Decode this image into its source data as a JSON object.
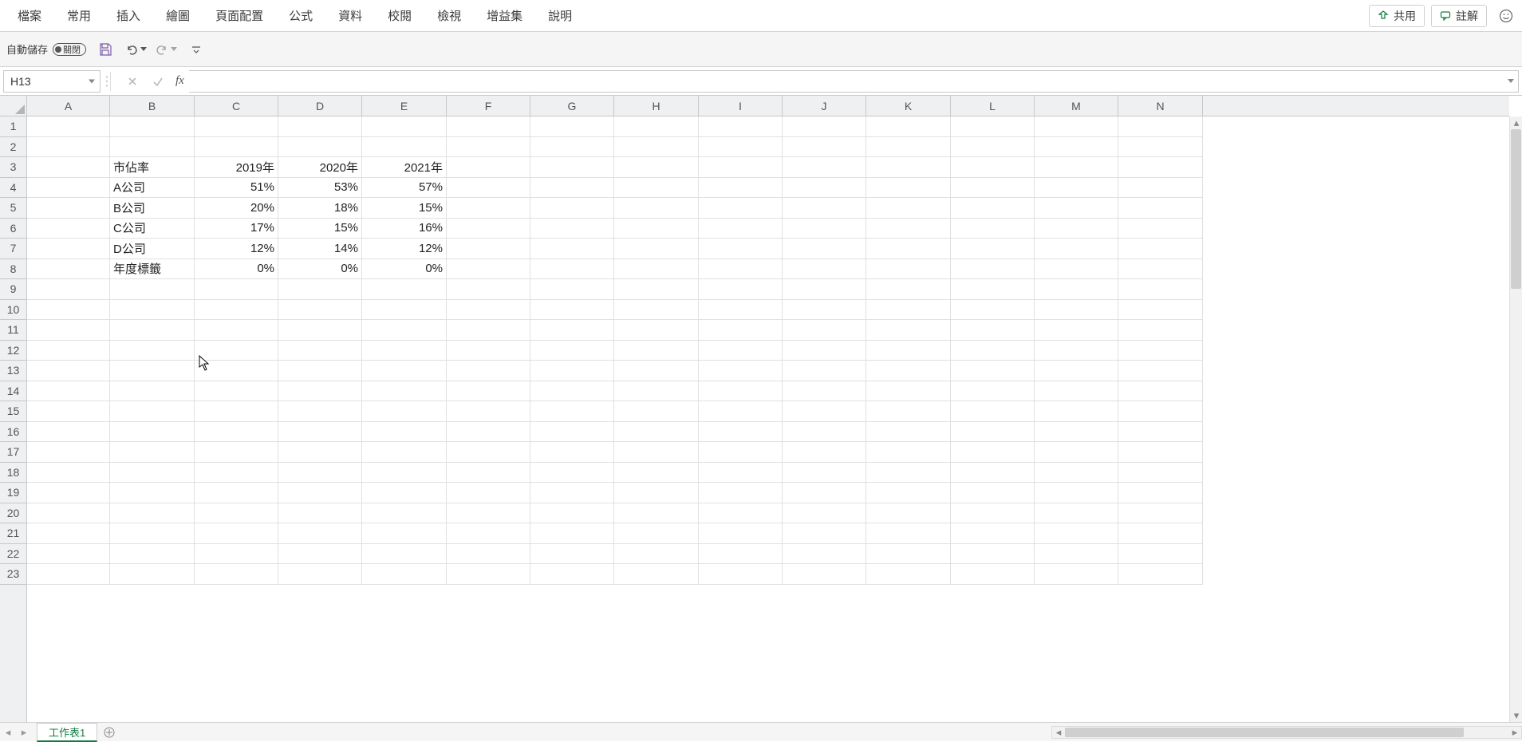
{
  "ribbon": {
    "tabs": [
      "檔案",
      "常用",
      "插入",
      "繪圖",
      "頁面配置",
      "公式",
      "資料",
      "校閱",
      "檢視",
      "增益集",
      "說明"
    ],
    "share": "共用",
    "comments": "註解"
  },
  "quickbar": {
    "autosave_label": "自動儲存",
    "autosave_state": "關閉"
  },
  "formula_bar": {
    "namebox": "H13",
    "fx_label": "fx",
    "value": ""
  },
  "columns": [
    "A",
    "B",
    "C",
    "D",
    "E",
    "F",
    "G",
    "H",
    "I",
    "J",
    "K",
    "L",
    "M",
    "N"
  ],
  "row_count": 23,
  "chart_data": {
    "type": "table",
    "title": "市佔率",
    "columns": [
      "2019年",
      "2020年",
      "2021年"
    ],
    "series": [
      {
        "name": "A公司",
        "values": [
          "51%",
          "53%",
          "57%"
        ]
      },
      {
        "name": "B公司",
        "values": [
          "20%",
          "18%",
          "15%"
        ]
      },
      {
        "name": "C公司",
        "values": [
          "17%",
          "15%",
          "16%"
        ]
      },
      {
        "name": "D公司",
        "values": [
          "12%",
          "14%",
          "12%"
        ]
      },
      {
        "name": "年度標籤",
        "values": [
          "0%",
          "0%",
          "0%"
        ]
      }
    ]
  },
  "sheet": {
    "active_tab": "工作表1"
  }
}
